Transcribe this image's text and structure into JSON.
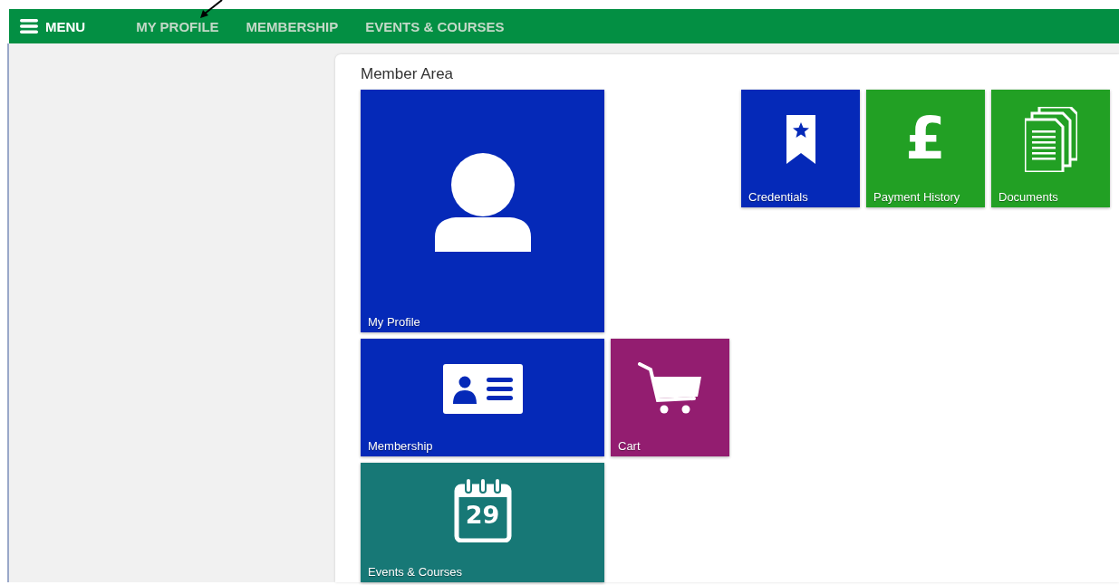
{
  "navbar": {
    "menu_label": "MENU",
    "links": [
      "MY PROFILE",
      "MEMBERSHIP",
      "EVENTS & COURSES"
    ]
  },
  "panel": {
    "title": "Member Area"
  },
  "tiles": [
    {
      "label": "My Profile",
      "kind": "profile",
      "color": "#0529b8"
    },
    {
      "label": "Membership",
      "kind": "membership",
      "color": "#0529b8"
    },
    {
      "label": "Cart",
      "kind": "cart",
      "color": "#931d70"
    },
    {
      "label": "Events & Courses",
      "kind": "events",
      "color": "#177876",
      "glyph": "29"
    },
    {
      "label": "Credentials",
      "kind": "credentials",
      "color": "#0529b8"
    },
    {
      "label": "Payment History",
      "kind": "payment",
      "color": "#22a024",
      "glyph": "£"
    },
    {
      "label": "Documents",
      "kind": "documents",
      "color": "#22a024"
    }
  ]
}
